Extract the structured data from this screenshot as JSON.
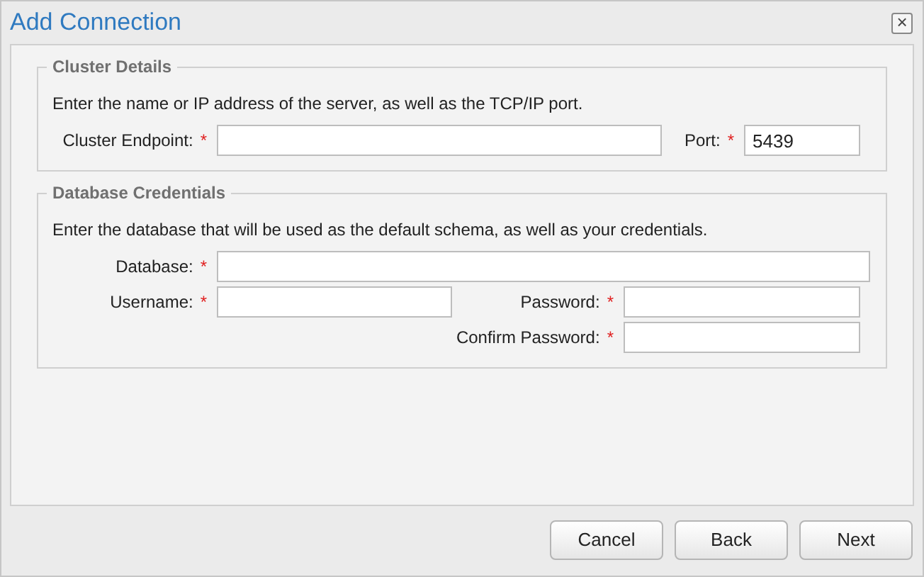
{
  "window": {
    "title": "Add Connection",
    "close": "×"
  },
  "fieldsets": [
    {
      "legend": "Cluster Details",
      "description": "Enter the name or IP address of the server, as well as the TCP/IP port.",
      "rows": [
        [
          {
            "label": "Cluster Endpoint:",
            "required_mark": "*"
          },
          {
            "label": "Port:",
            "required_mark": "*",
            "value": "5439"
          }
        ]
      ]
    },
    {
      "legend": "Database Credentials",
      "description": "Enter the database that will be used as the default schema, as well as your credentials.",
      "rows": [
        [
          {
            "label": "Database:",
            "required_mark": "*"
          }
        ],
        [
          {
            "label": "Username:",
            "required_mark": "*"
          },
          {
            "label": "Password:",
            "required_mark": "*"
          }
        ],
        [
          "",
          {
            "label": "Confirm Password:",
            "required_mark": "*"
          }
        ]
      ]
    }
  ],
  "buttons": [
    "Cancel",
    "Back",
    "Next"
  ]
}
